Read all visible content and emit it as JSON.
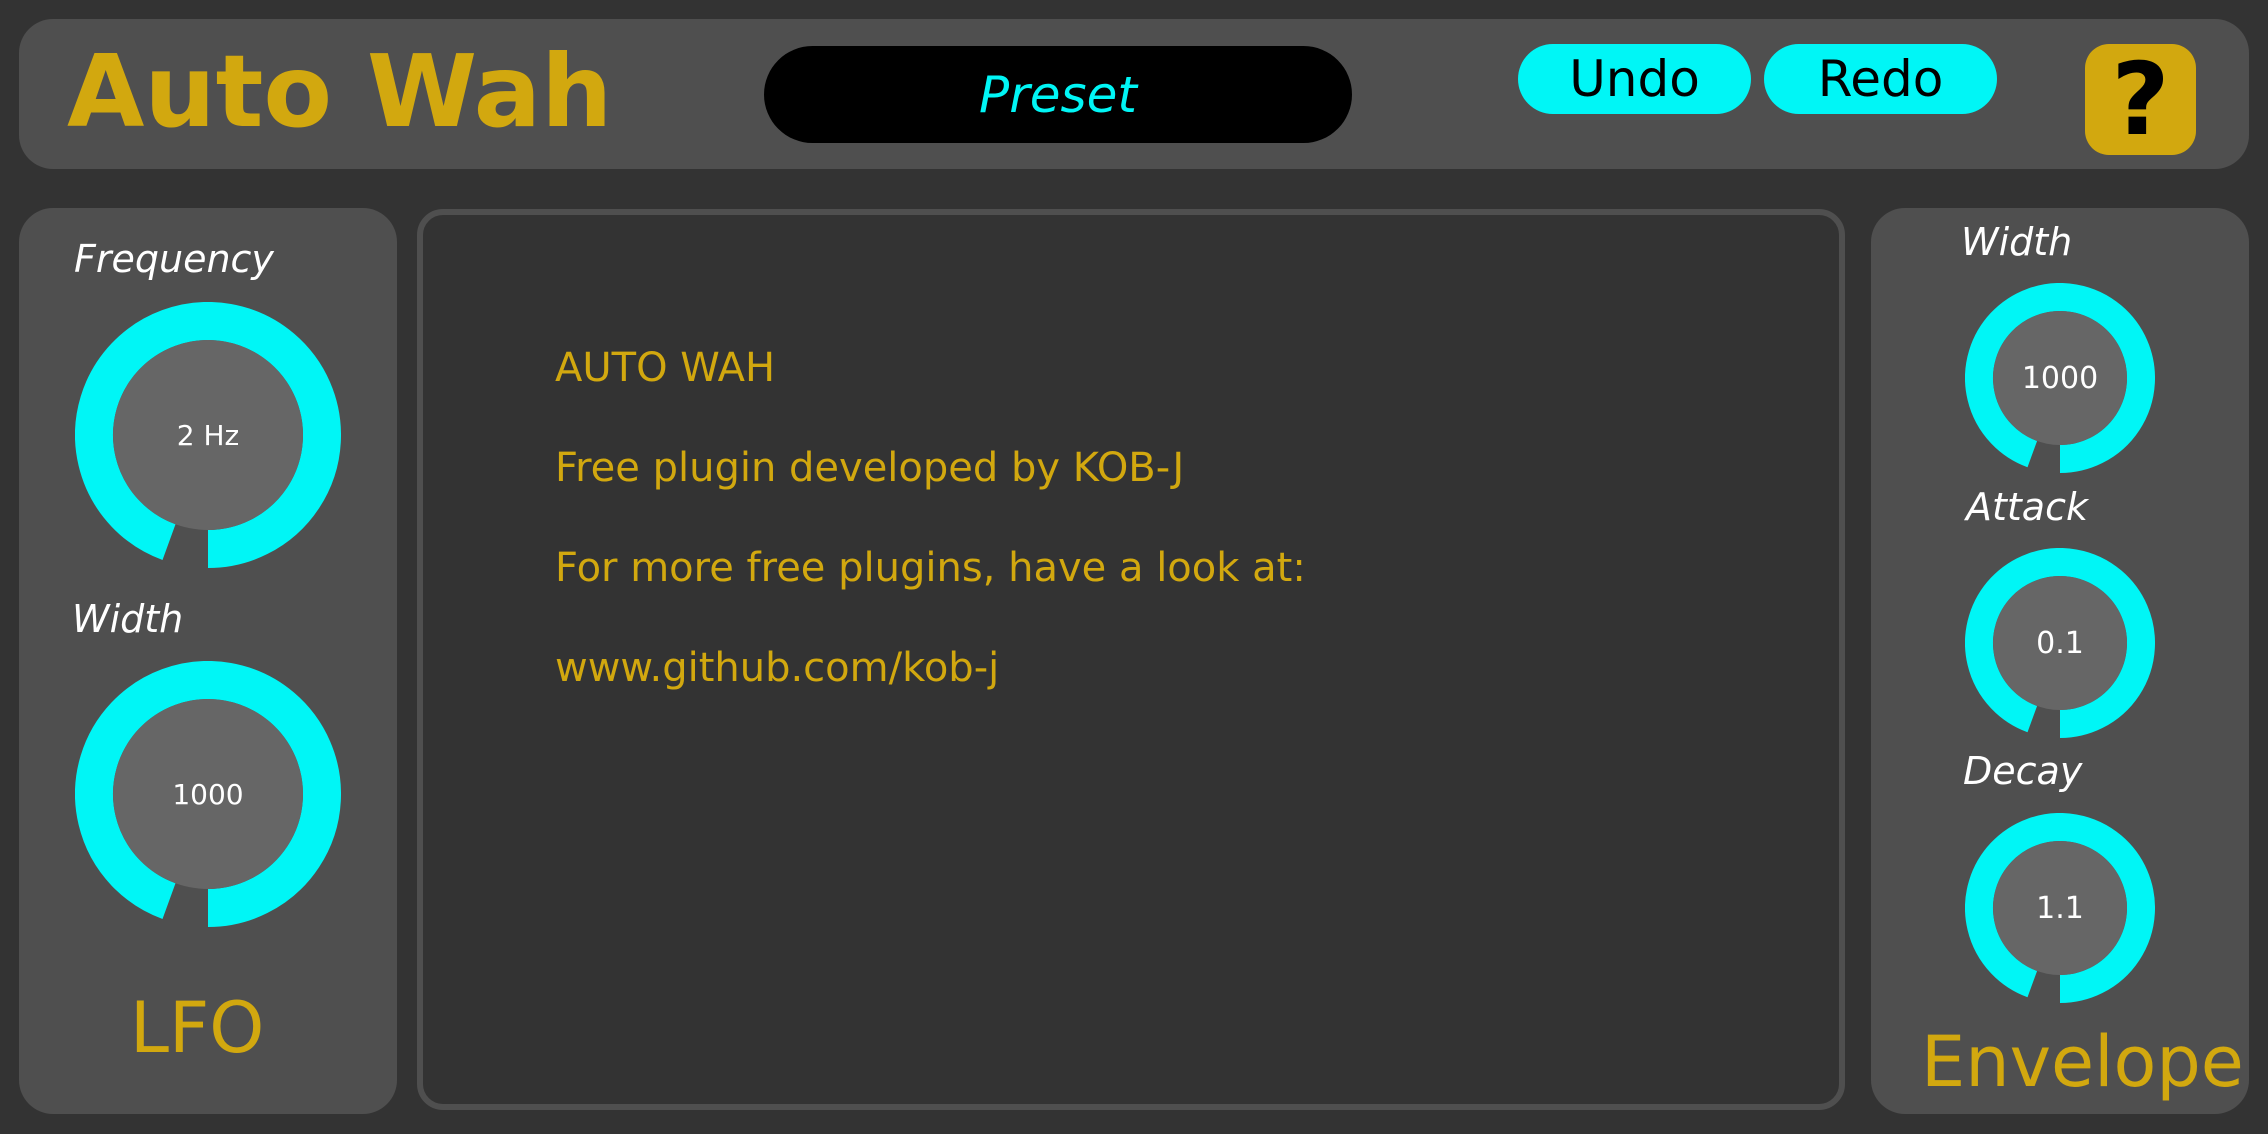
{
  "header": {
    "title": "Auto Wah",
    "preset_label": "Preset",
    "undo_label": "Undo",
    "redo_label": "Redo",
    "help_label": "?"
  },
  "lfo": {
    "section_label": "LFO",
    "knobs": [
      {
        "label": "Frequency",
        "value": "2 Hz",
        "level": 1.0
      },
      {
        "label": "Width",
        "value": "1000",
        "level": 1.0
      }
    ]
  },
  "envelope": {
    "section_label": "Envelope",
    "knobs": [
      {
        "label": "Width",
        "value": "1000",
        "level": 1.0
      },
      {
        "label": "Attack",
        "value": "0.1",
        "level": 1.0
      },
      {
        "label": "Decay",
        "value": "1.1",
        "level": 1.0
      }
    ]
  },
  "info": {
    "lines": [
      "AUTO WAH",
      "Free plugin developed by KOB-J",
      "For more free plugins, have a look at:",
      "www.github.com/kob-j"
    ]
  },
  "colors": {
    "accent": "#00f6f6",
    "gold": "#d2a80f",
    "panel": "#4f4f4f",
    "background": "#333333",
    "knob_body": "#666666"
  }
}
